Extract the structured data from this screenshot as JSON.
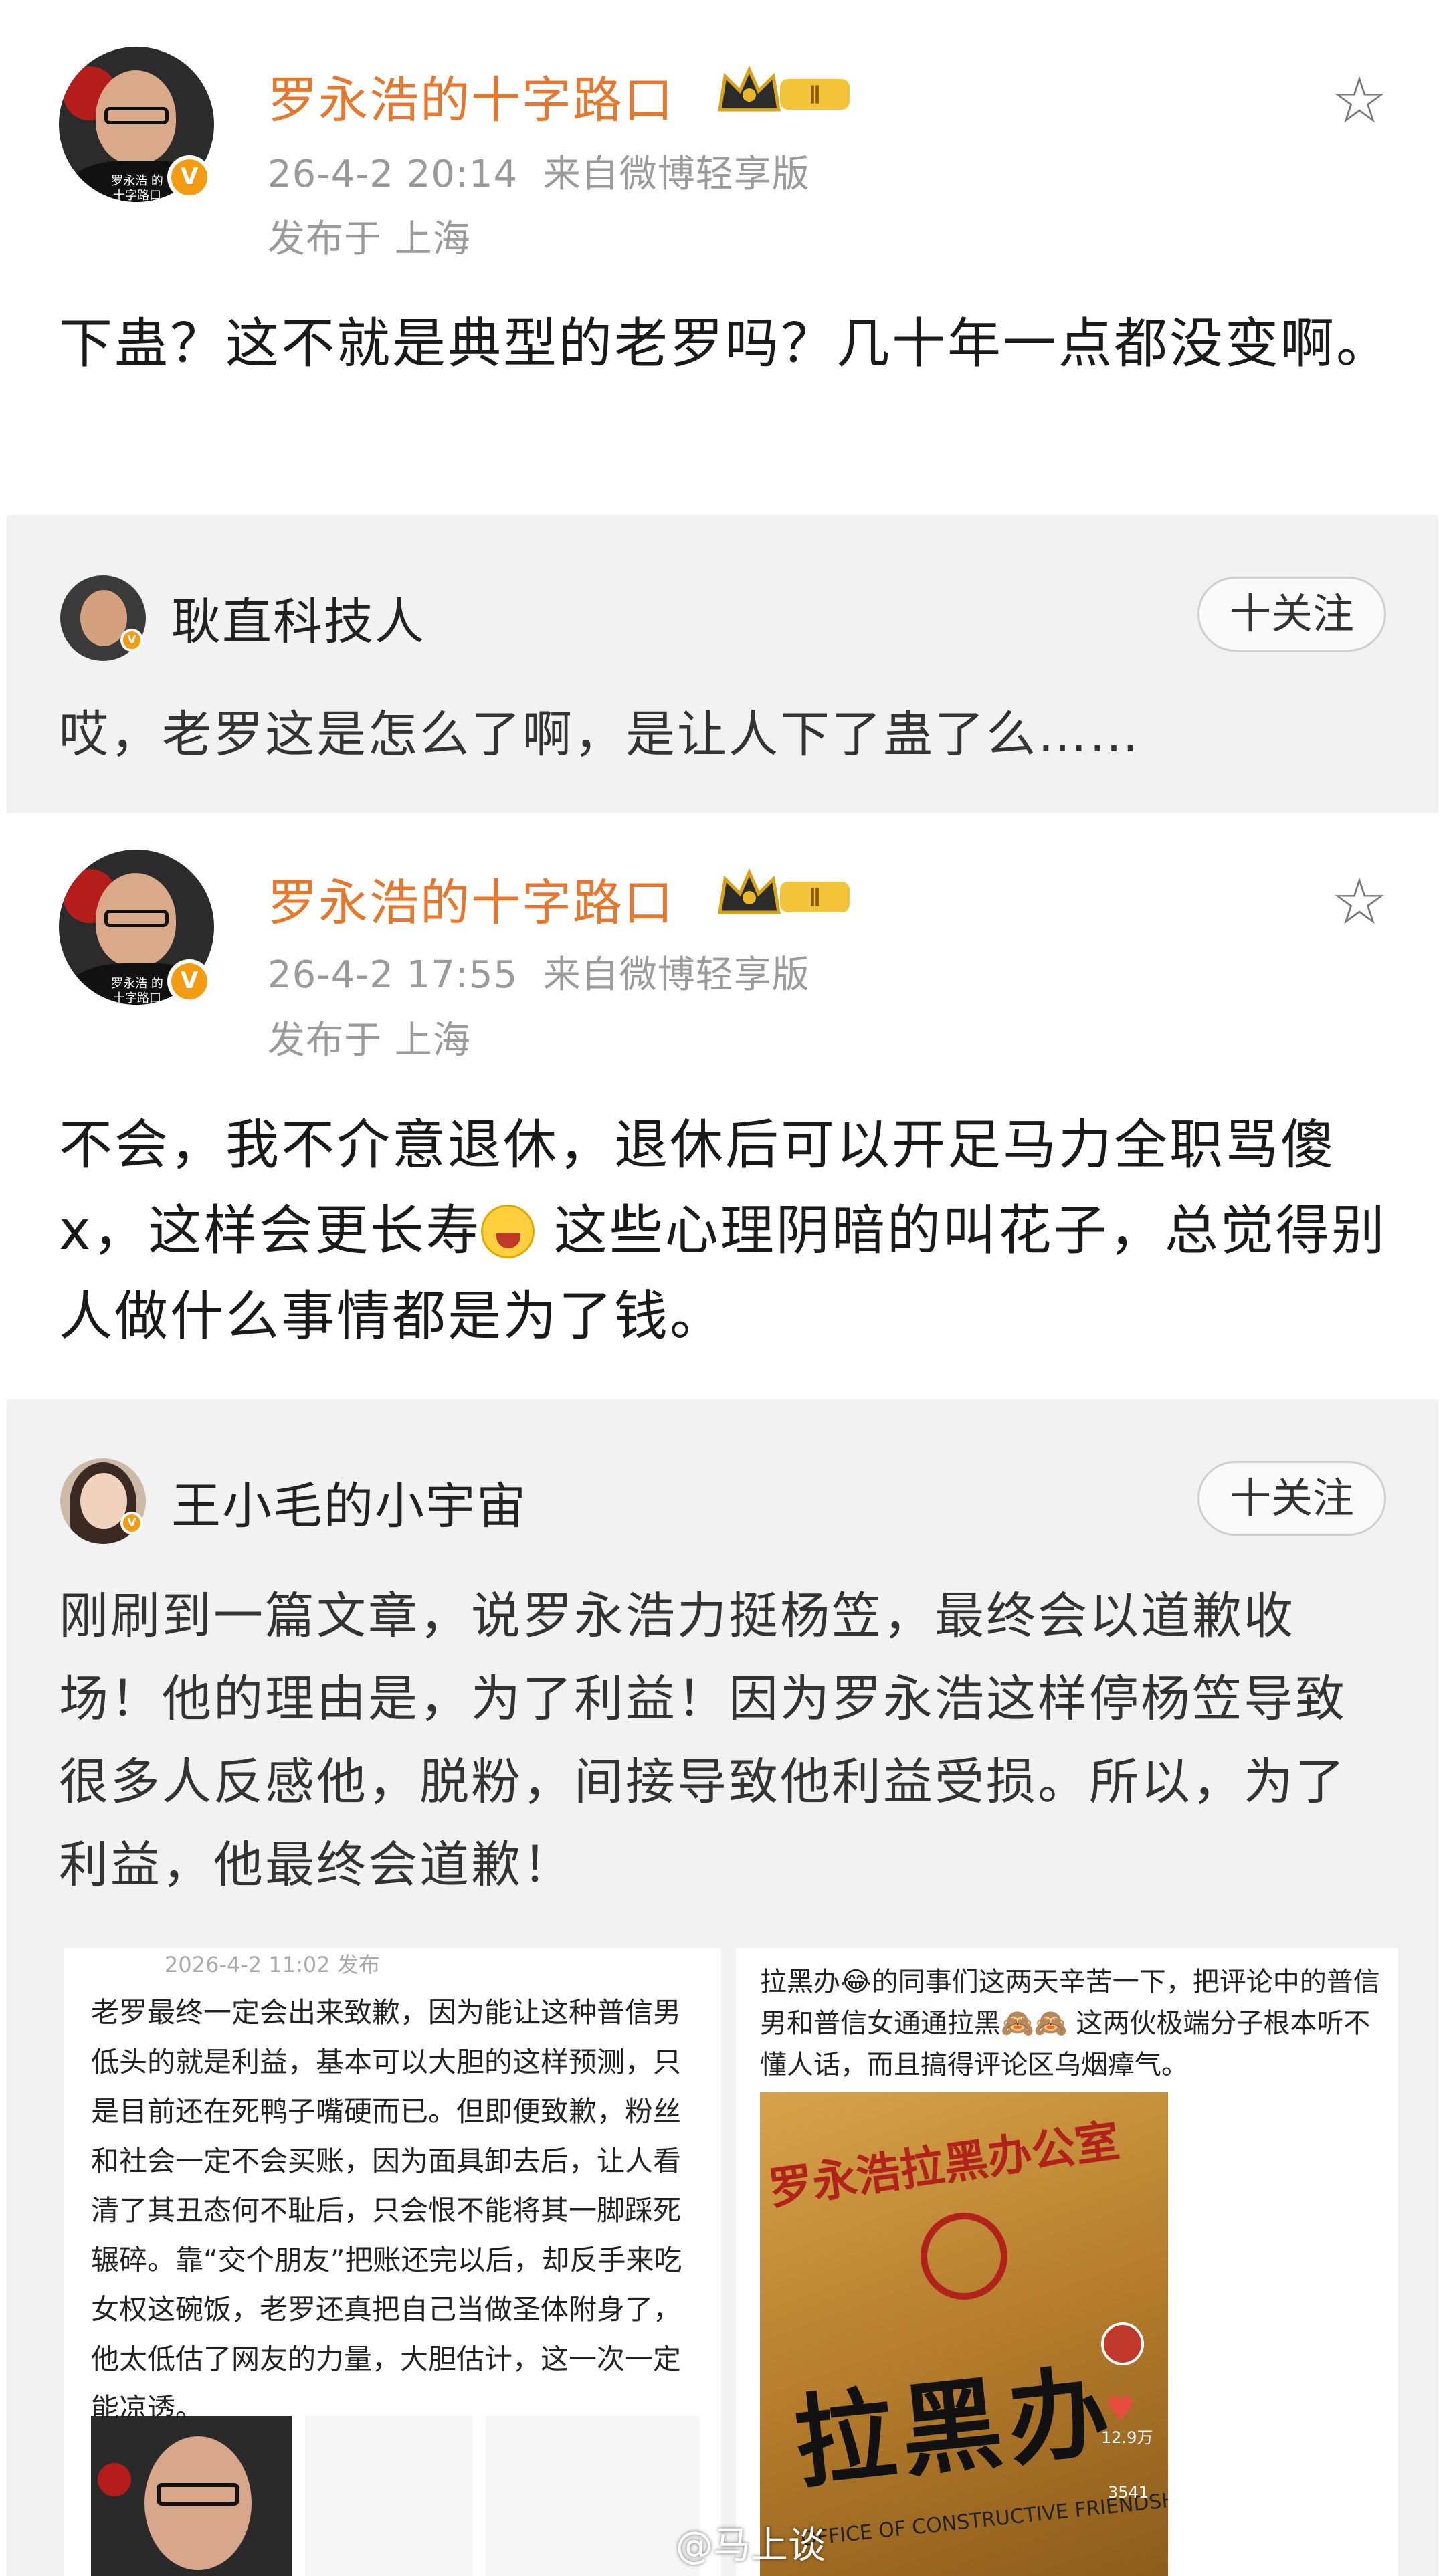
{
  "post1": {
    "author": "罗永浩的十字路口",
    "avatar_caption": "罗永浩 的十字路口",
    "level_badge": "Ⅱ",
    "time": "26-4-2 20:14",
    "source": "来自微博轻享版",
    "location": "发布于 上海",
    "text": "下蛊？这不就是典型的老罗吗？几十年一点都没变啊。"
  },
  "quote1": {
    "name": "耿直科技人",
    "follow_label": "十关注",
    "text": "哎，老罗这是怎么了啊，是让人下了蛊了么……"
  },
  "post2": {
    "author": "罗永浩的十字路口",
    "avatar_caption": "罗永浩 的十字路口",
    "level_badge": "Ⅱ",
    "time": "26-4-2 17:55",
    "source": "来自微博轻享版",
    "location": "发布于 上海",
    "text_a": "不会，我不介意退休，退休后可以开足马力全职骂傻x，这样会更长寿",
    "text_b": " 这些心理阴暗的叫花子，总觉得别人做什么事情都是为了钱。"
  },
  "quote2": {
    "name": "王小毛的小宇宙",
    "follow_label": "十关注",
    "text": "刚刷到一篇文章，说罗永浩力挺杨笠，最终会以道歉收场！他的理由是，为了利益！因为罗永浩这样停杨笠导致很多人反感他，脱粉，间接导致他利益受损。所以，为了利益，他最终会道歉！"
  },
  "image_left": {
    "header": "2026-4-2 11:02 发布",
    "text": "老罗最终一定会出来致歉，因为能让这种普信男低头的就是利益，基本可以大胆的这样预测，只是目前还在死鸭子嘴硬而已。但即便致歉，粉丝和社会一定不会买账，因为面具卸去后，让人看清了其丑态何不耻后，只会恨不能将其一脚踩死辗碎。靠“交个朋友”把账还完以后，却反手来吃女权这碗饭，老罗还真把自己当做圣体附身了，他太低估了网友的力量，大胆估计，这一次一定能凉透。"
  },
  "image_right": {
    "text": "拉黑办😂的同事们这两天辛苦一下，把评论中的普信男和普信女通通拉黑🙈🙈 这两伙极端分子根本听不懂人话，而且搞得评论区乌烟瘴气。",
    "sign_top": "罗永浩拉黑办公室",
    "sign_main": "拉黑办",
    "sign_en": "OFFICE OF CONSTRUCTIVE FRIENDSHIP",
    "side_count_1": "12.9万",
    "side_count_2": "3541"
  },
  "watermark": "@马上谈",
  "colors": {
    "author": "#e8762d",
    "meta": "#9a9a9a",
    "quote_bg": "#f2f2f2",
    "badge": "#f39c12"
  }
}
